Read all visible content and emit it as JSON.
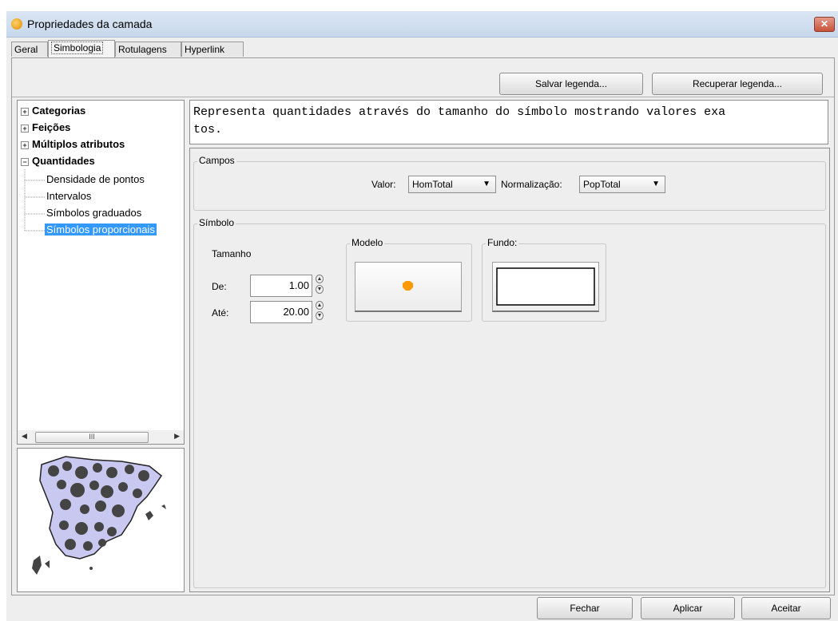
{
  "window": {
    "title": "Propriedades da camada",
    "close_glyph": "✕"
  },
  "tabs": [
    {
      "label": "Geral"
    },
    {
      "label": "Simbologia"
    },
    {
      "label": "Rotulagens"
    },
    {
      "label": "Hyperlink"
    }
  ],
  "toolbar": {
    "save_legend": "Salvar legenda...",
    "load_legend": "Recuperar legenda..."
  },
  "tree": {
    "categories": [
      {
        "label": "Categorias",
        "expander": "+"
      },
      {
        "label": "Feições",
        "expander": "+"
      },
      {
        "label": "Múltiplos atributos",
        "expander": "+"
      },
      {
        "label": "Quantidades",
        "expander": "−"
      }
    ],
    "children": [
      {
        "label": "Densidade de pontos"
      },
      {
        "label": "Intervalos"
      },
      {
        "label": "Símbolos graduados"
      },
      {
        "label": "Símbolos proporcionais"
      }
    ],
    "scroll_thumb_glyph": "III"
  },
  "description": {
    "line1": "Representa quantidades através do tamanho do símbolo mostrando valores exa",
    "line2": "tos."
  },
  "campos": {
    "legend": "Campos",
    "valor_label": "Valor:",
    "valor_value": "HomTotal",
    "normalizacao_label": "Normalização:",
    "normalizacao_value": "PopTotal"
  },
  "simbolo": {
    "legend": "Símbolo",
    "tamanho_label": "Tamanho",
    "de_label": "De:",
    "de_value": "1.00",
    "ate_label": "Até:",
    "ate_value": "20.00",
    "modelo_label": "Modelo",
    "fundo_label": "Fundo:"
  },
  "buttons": {
    "close": "Fechar",
    "apply": "Aplicar",
    "accept": "Aceitar"
  },
  "colors": {
    "selection": "#3399ff",
    "symbol": "#ff9900",
    "map_fill": "#c8c8f0"
  }
}
